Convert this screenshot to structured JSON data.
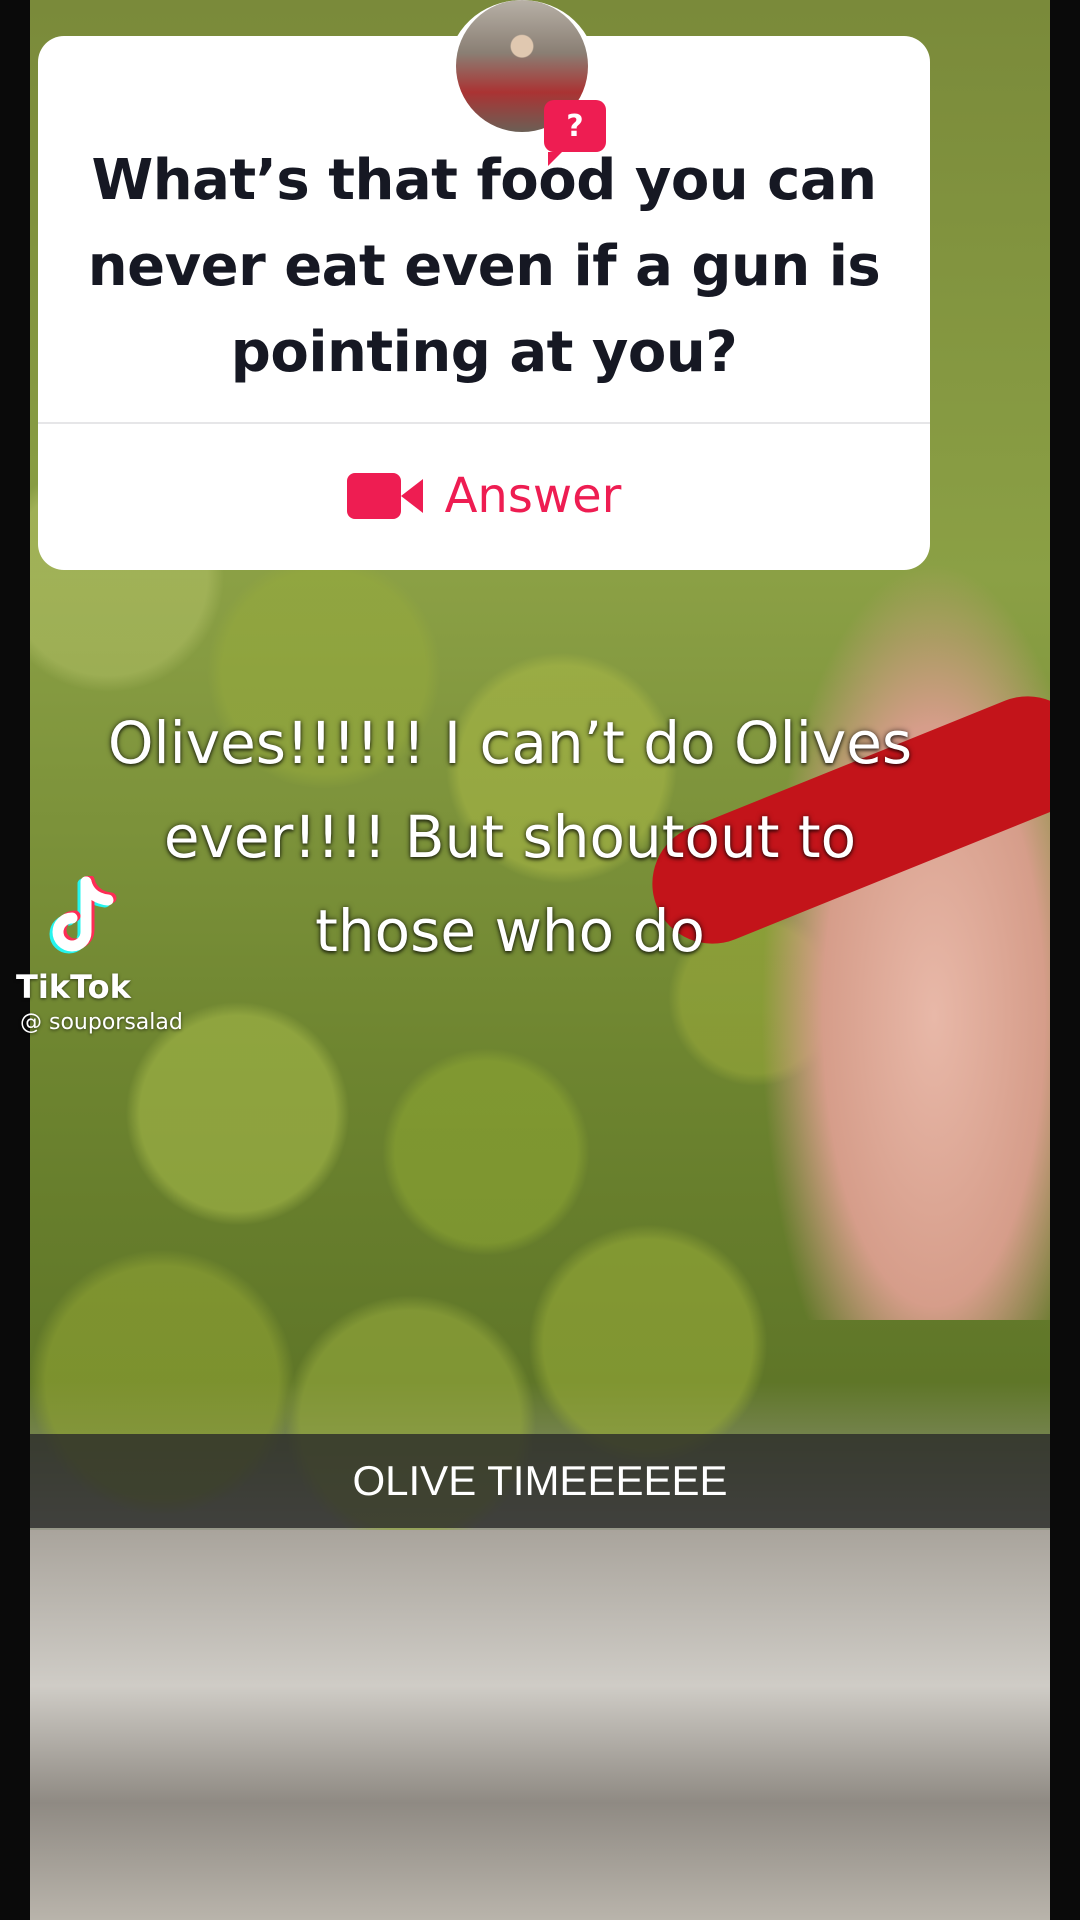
{
  "question_card": {
    "question": "What’s that food you can never eat even if a gun is pointing at you?",
    "question_badge": "?",
    "answer_label": "Answer",
    "answer_icon": "video-camera-icon",
    "accent_color": "#ee1d52"
  },
  "overlay_caption": {
    "lines": [
      "Olives!!!!!! I can’t do Olives",
      "ever!!!! But shoutout to",
      "those who do"
    ]
  },
  "watermark": {
    "brand": "TikTok",
    "handle": "@ souporsalad",
    "icon": "tiktok-note-icon"
  },
  "snap_caption": {
    "text": "OLIVE TIMEEEEEE"
  }
}
